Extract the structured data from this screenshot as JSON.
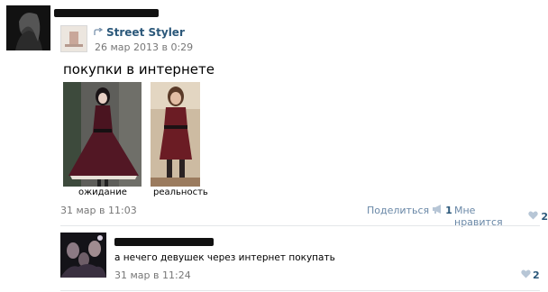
{
  "post": {
    "repost": {
      "source_name": "Street Styler",
      "date": "26 мар 2013 в 0:29"
    },
    "text": "покупки в интернете",
    "photos": [
      {
        "caption": "ожидание"
      },
      {
        "caption": "реальность"
      }
    ],
    "date": "31 мар в 11:03",
    "share_label": "Поделиться",
    "share_count": "1",
    "like_label": "Мне нравится",
    "like_count": "2"
  },
  "comment": {
    "text": "а нечего девушек через интернет покупать",
    "date": "31 мар в 11:24",
    "like_count": "2"
  },
  "colors": {
    "link": "#2b587a",
    "meta": "#777777",
    "action": "#6a88a7",
    "divider": "#e4e6e9"
  },
  "icons": {
    "repost": "repost-arrow-icon",
    "share": "megaphone-icon",
    "like": "heart-icon"
  }
}
